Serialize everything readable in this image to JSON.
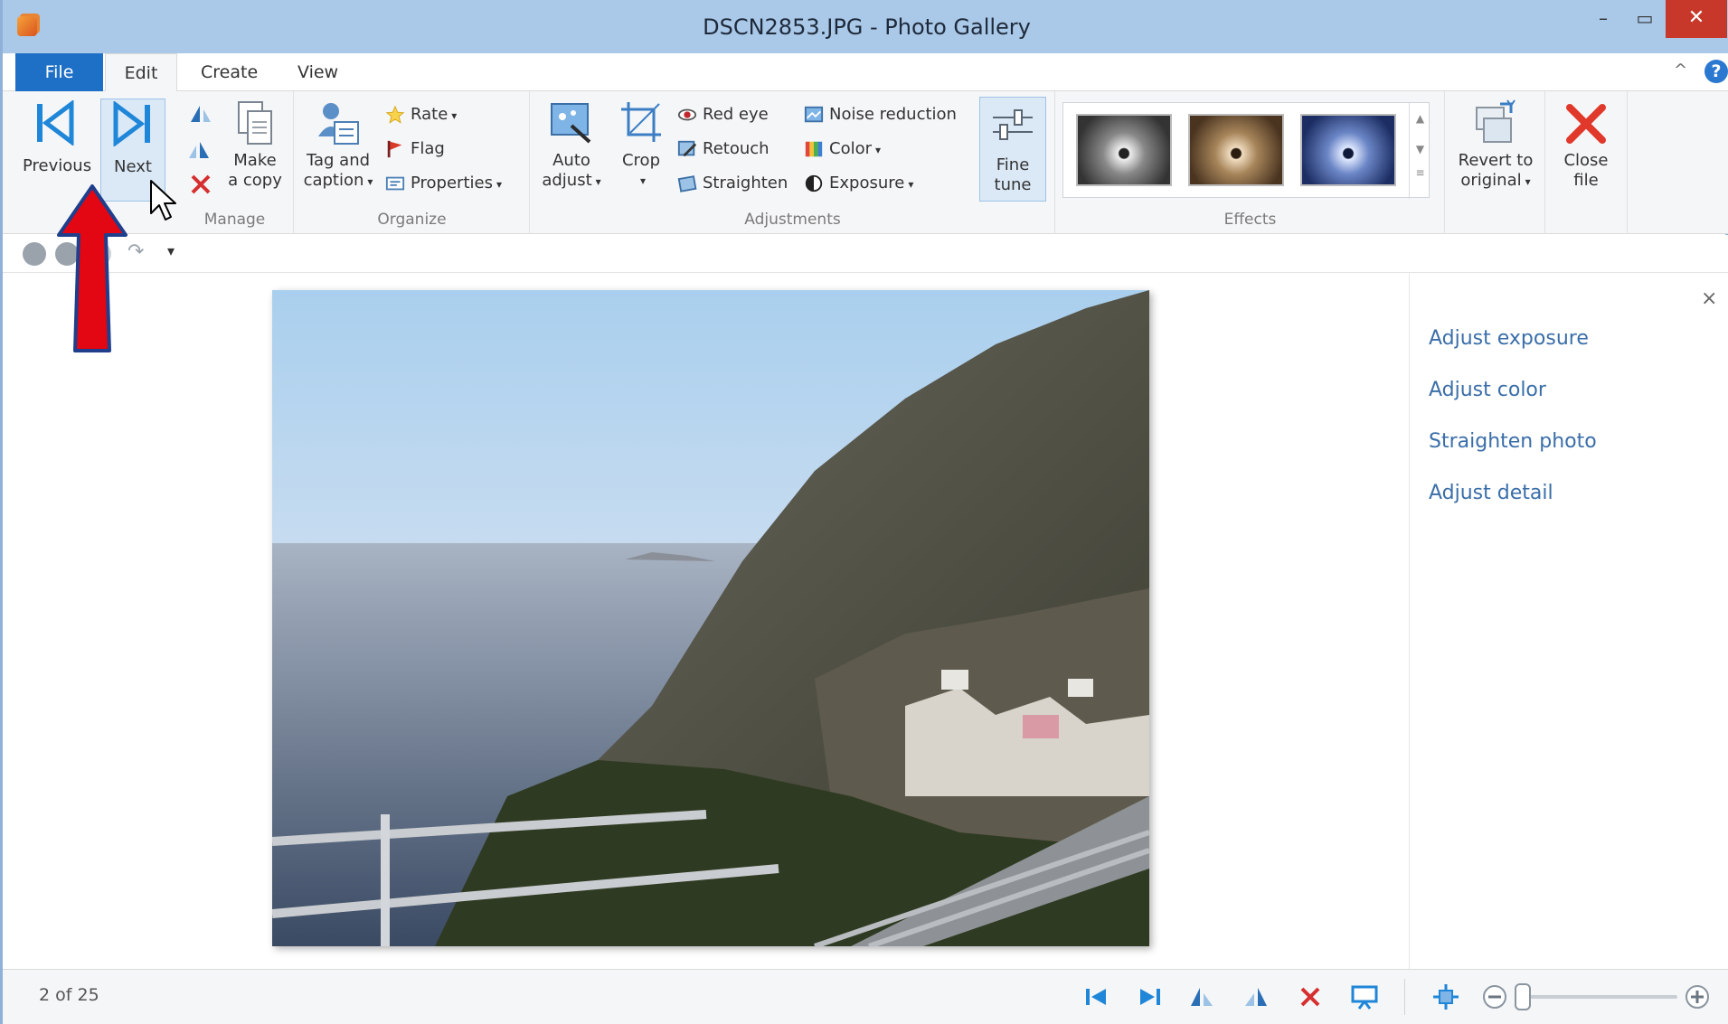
{
  "window": {
    "title": "DSCN2853.JPG - Photo Gallery",
    "min_glyph": "–",
    "max_glyph": "▭",
    "close_glyph": "✕"
  },
  "tabs": {
    "file": "File",
    "edit": "Edit",
    "create": "Create",
    "view": "View",
    "collapse_glyph": "^",
    "help_glyph": "?"
  },
  "ribbon": {
    "previous": "Previous",
    "next": "Next",
    "make_copy_1": "Make",
    "make_copy_2": "a copy",
    "manage": "Manage",
    "tag_1": "Tag and",
    "tag_2": "caption",
    "rate": "Rate",
    "flag": "Flag",
    "properties": "Properties",
    "organize": "Organize",
    "auto_1": "Auto",
    "auto_2": "adjust",
    "crop": "Crop",
    "red_eye": "Red eye",
    "retouch": "Retouch",
    "straighten": "Straighten",
    "noise": "Noise reduction",
    "color": "Color",
    "exposure": "Exposure",
    "fine_1": "Fine",
    "fine_2": "tune",
    "adjustments": "Adjustments",
    "effects": "Effects",
    "revert_1": "Revert to",
    "revert_2": "original",
    "close_1": "Close",
    "close_2": "file",
    "caret": "▾"
  },
  "qat": {
    "more_glyph": "▾"
  },
  "pane": {
    "close_glyph": "×",
    "links": [
      "Adjust exposure",
      "Adjust color",
      "Straighten photo",
      "Adjust detail"
    ]
  },
  "status": {
    "count": "2 of 25"
  },
  "colors": {
    "accent": "#1e6fc6",
    "title_bar": "#aac8e8",
    "close_red": "#c7382b",
    "link": "#3a6ea8",
    "annotation_arrow": "#e30613"
  },
  "icons": [
    "previous-icon",
    "next-icon",
    "rotate-left-icon",
    "rotate-right-icon",
    "delete-icon",
    "copy-icon",
    "tag-icon",
    "star-icon",
    "flag-icon",
    "properties-icon",
    "auto-adjust-icon",
    "crop-icon",
    "red-eye-icon",
    "retouch-icon",
    "straighten-icon",
    "noise-icon",
    "color-icon",
    "exposure-icon",
    "fine-tune-icon",
    "revert-icon",
    "close-file-icon"
  ]
}
